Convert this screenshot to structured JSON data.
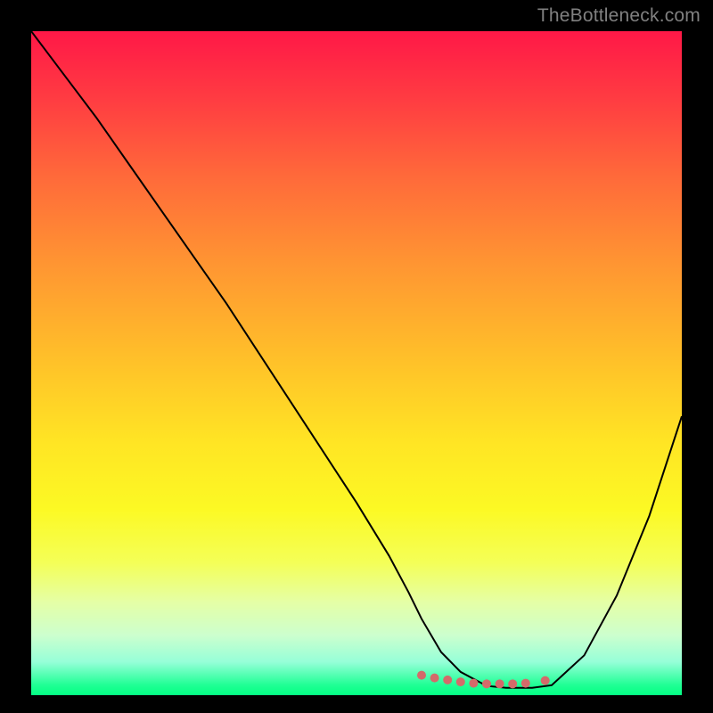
{
  "watermark": "TheBottleneck.com",
  "chart_data": {
    "type": "line",
    "title": "",
    "xlabel": "",
    "ylabel": "",
    "xlim": [
      0,
      100
    ],
    "ylim": [
      0,
      100
    ],
    "background_gradient": {
      "stops": [
        {
          "offset": 0.0,
          "color": "#ff1847"
        },
        {
          "offset": 0.1,
          "color": "#ff3b42"
        },
        {
          "offset": 0.22,
          "color": "#ff6a3a"
        },
        {
          "offset": 0.35,
          "color": "#ff9532"
        },
        {
          "offset": 0.5,
          "color": "#ffc229"
        },
        {
          "offset": 0.62,
          "color": "#ffe524"
        },
        {
          "offset": 0.72,
          "color": "#fcf924"
        },
        {
          "offset": 0.8,
          "color": "#f4ff57"
        },
        {
          "offset": 0.86,
          "color": "#e5ffa6"
        },
        {
          "offset": 0.91,
          "color": "#ccffce"
        },
        {
          "offset": 0.95,
          "color": "#96ffd8"
        },
        {
          "offset": 0.985,
          "color": "#1fff94"
        },
        {
          "offset": 1.0,
          "color": "#03ff83"
        }
      ]
    },
    "series": [
      {
        "name": "bottleneck-curve",
        "color": "#000000",
        "width": 2.0,
        "x": [
          0,
          5,
          10,
          15,
          20,
          25,
          30,
          35,
          40,
          45,
          50,
          55,
          58,
          60,
          63,
          66,
          70,
          73,
          77,
          80,
          85,
          90,
          95,
          100
        ],
        "y": [
          100,
          93.5,
          87,
          80,
          73,
          66,
          59,
          51.5,
          44,
          36.5,
          29,
          21,
          15.5,
          11.5,
          6.5,
          3.5,
          1.4,
          1.1,
          1.1,
          1.5,
          6,
          15,
          27,
          42
        ]
      }
    ],
    "markers": {
      "name": "highlight-range",
      "color": "#d46a6a",
      "radius": 5,
      "points": [
        {
          "x": 60,
          "y": 3.0
        },
        {
          "x": 62,
          "y": 2.6
        },
        {
          "x": 64,
          "y": 2.3
        },
        {
          "x": 66,
          "y": 2.0
        },
        {
          "x": 68,
          "y": 1.8
        },
        {
          "x": 70,
          "y": 1.7
        },
        {
          "x": 72,
          "y": 1.7
        },
        {
          "x": 74,
          "y": 1.7
        },
        {
          "x": 76,
          "y": 1.8
        },
        {
          "x": 79,
          "y": 2.2
        }
      ]
    }
  }
}
